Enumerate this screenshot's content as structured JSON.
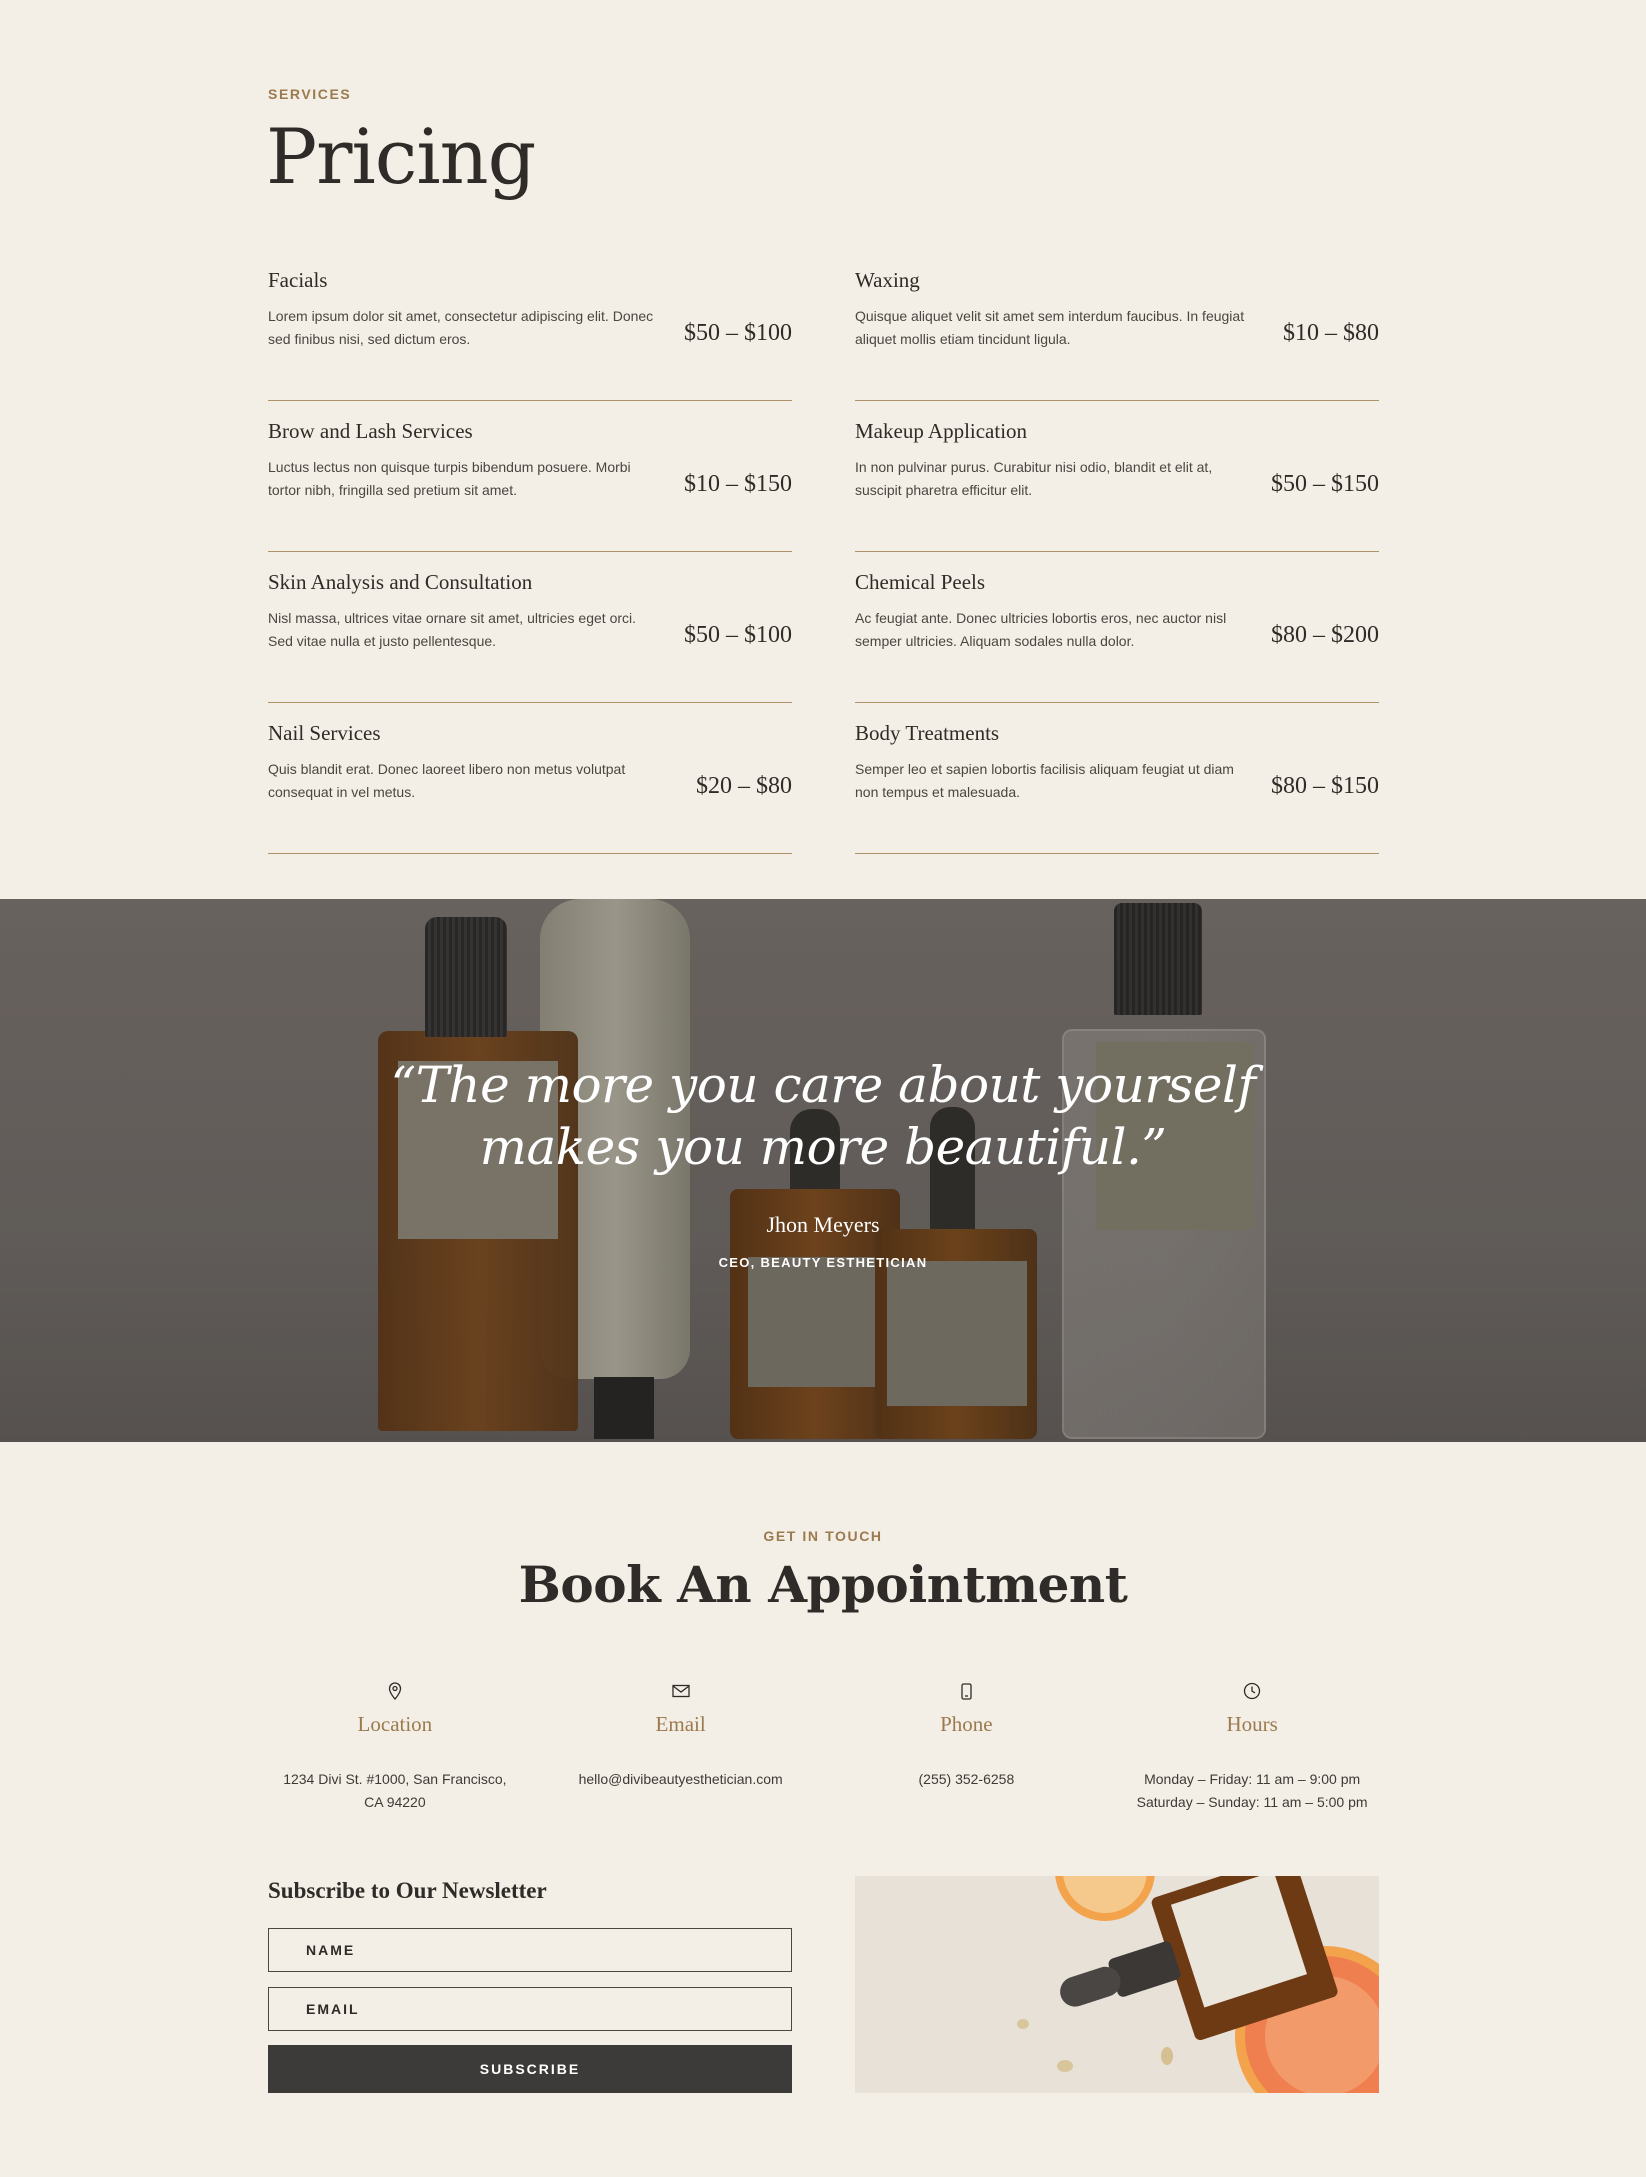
{
  "pricing": {
    "eyebrow": "SERVICES",
    "title": "Pricing",
    "items": [
      {
        "name": "Facials",
        "desc": "Lorem ipsum dolor sit amet, consectetur adipiscing elit. Donec sed finibus nisi, sed dictum eros.",
        "price": "$50 – $100"
      },
      {
        "name": "Waxing",
        "desc": "Quisque aliquet velit sit amet sem interdum faucibus. In feugiat aliquet mollis etiam tincidunt ligula.",
        "price": "$10 – $80"
      },
      {
        "name": "Brow and Lash Services",
        "desc": "Luctus lectus non quisque turpis bibendum posuere. Morbi tortor nibh, fringilla sed pretium sit amet.",
        "price": "$10 – $150"
      },
      {
        "name": "Makeup Application",
        "desc": "In non pulvinar purus. Curabitur nisi odio, blandit et elit at, suscipit pharetra efficitur elit.",
        "price": "$50 – $150"
      },
      {
        "name": "Skin Analysis and Consultation",
        "desc": "Nisl massa, ultrices vitae ornare sit amet, ultricies eget orci. Sed vitae nulla et justo pellentesque.",
        "price": "$50 – $100"
      },
      {
        "name": "Chemical Peels",
        "desc": "Ac feugiat ante. Donec ultricies lobortis eros, nec auctor nisl semper ultricies. Aliquam sodales nulla dolor.",
        "price": "$80 – $200"
      },
      {
        "name": "Nail Services",
        "desc": "Quis blandit erat. Donec laoreet libero non metus volutpat consequat in vel metus.",
        "price": "$20 – $80"
      },
      {
        "name": "Body Treatments",
        "desc": "Semper leo et sapien lobortis facilisis aliquam feugiat ut diam non tempus et malesuada.",
        "price": "$80 – $150"
      }
    ]
  },
  "quote": {
    "line1": "“The more you care about yourself",
    "line2": "makes you more beautiful.”",
    "author": "Jhon Meyers",
    "role": "CEO, BEAUTY ESTHETICIAN"
  },
  "appointment": {
    "eyebrow": "GET IN TOUCH",
    "title": "Book An Appointment",
    "contacts": [
      {
        "icon": "map-pin-icon",
        "title": "Location",
        "lines": [
          "1234 Divi St. #1000, San Francisco,",
          "CA 94220"
        ]
      },
      {
        "icon": "envelope-icon",
        "title": "Email",
        "lines": [
          "hello@divibeautyesthetician.com",
          ""
        ]
      },
      {
        "icon": "phone-icon",
        "title": "Phone",
        "lines": [
          "(255) 352-6258",
          ""
        ]
      },
      {
        "icon": "clock-icon",
        "title": "Hours",
        "lines": [
          "Monday – Friday: 11 am – 9:00 pm",
          "Saturday – Sunday: 11 am – 5:00 pm"
        ]
      }
    ]
  },
  "newsletter": {
    "title": "Subscribe to Our Newsletter",
    "name_placeholder": "NAME",
    "email_placeholder": "EMAIL",
    "button_label": "SUBSCRIBE"
  },
  "colors": {
    "background": "#f3efe6",
    "accent": "#9b7a4e",
    "divider": "#ad926a",
    "button": "#3c3b3a",
    "text": "#2e2b28"
  }
}
